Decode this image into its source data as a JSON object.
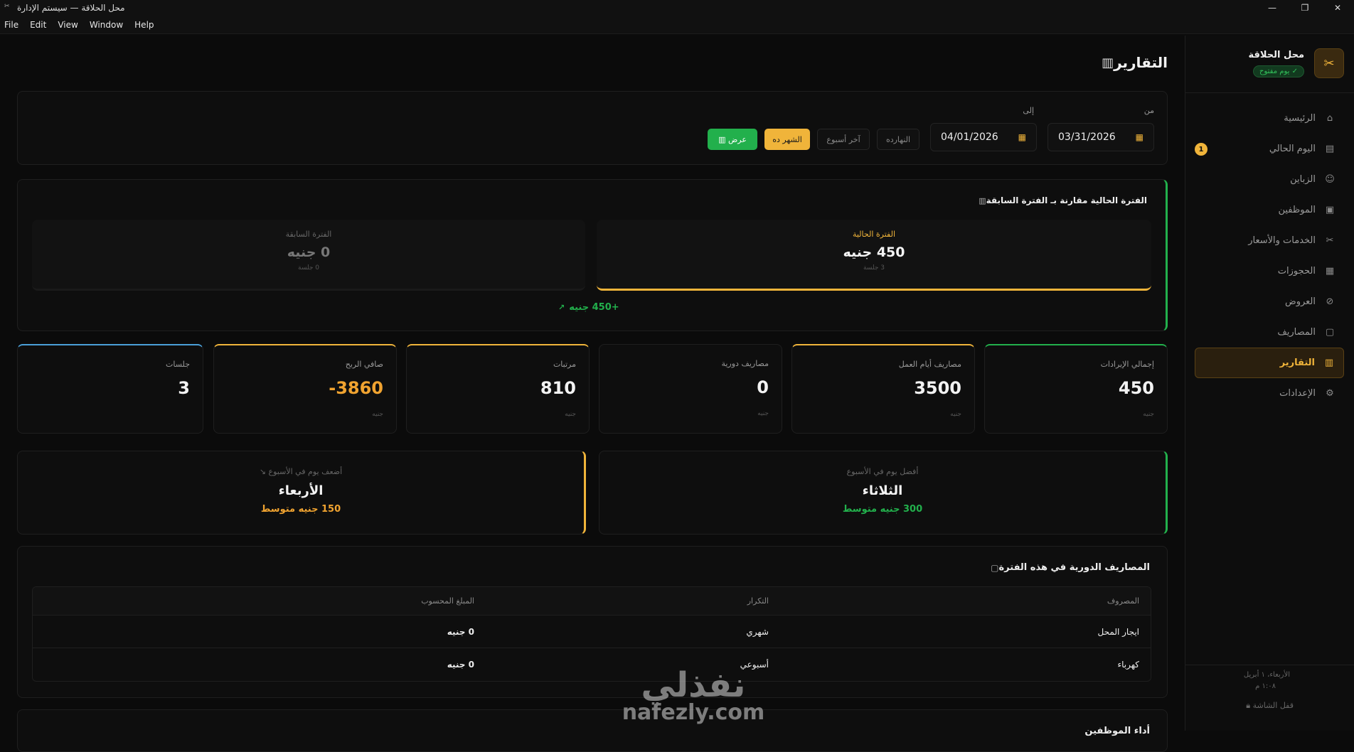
{
  "window": {
    "title": "محل الحلاقة — سيستم الإدارة",
    "controls": [
      "—",
      "❐",
      "✕"
    ]
  },
  "menubar": [
    "File",
    "Edit",
    "View",
    "Window",
    "Help"
  ],
  "sidebar": {
    "brand_name": "محل الحلاقة",
    "brand_status": "يوم مفتوح",
    "items": [
      {
        "label": "الرئيسية",
        "icon": "home-icon",
        "glyph": "⌂",
        "active": false
      },
      {
        "label": "اليوم الحالي",
        "icon": "calendar-today-icon",
        "glyph": "▤",
        "active": false,
        "badge": "1"
      },
      {
        "label": "الزباين",
        "icon": "users-icon",
        "glyph": "☺",
        "active": false
      },
      {
        "label": "الموظفين",
        "icon": "id-card-icon",
        "glyph": "▣",
        "active": false
      },
      {
        "label": "الخدمات والأسعار",
        "icon": "scissors-icon",
        "glyph": "✂",
        "active": false
      },
      {
        "label": "الحجوزات",
        "icon": "calendar-icon",
        "glyph": "▦",
        "active": false
      },
      {
        "label": "العروض",
        "icon": "tag-icon",
        "glyph": "⊘",
        "active": false
      },
      {
        "label": "المصاريف",
        "icon": "wallet-icon",
        "glyph": "▢",
        "active": false
      },
      {
        "label": "التقارير",
        "icon": "bar-chart-icon",
        "glyph": "▥",
        "active": true
      },
      {
        "label": "الإعدادات",
        "icon": "gear-icon",
        "glyph": "⚙",
        "active": false
      }
    ],
    "footer_date": "الأربعاء، ١ أبريل",
    "footer_time": "١:٠٨ م",
    "footer_lock": "قفل الشاشة"
  },
  "page": {
    "title": "التقارير"
  },
  "filter": {
    "from_label": "من",
    "to_label": "إلى",
    "from_value": "03/31/2026",
    "to_value": "04/01/2026",
    "today": "النهارده",
    "last_week": "آخر أسبوع",
    "this_month": "الشهر ده",
    "show": "عرض"
  },
  "comparison": {
    "title": "الفترة الحالية مقارنة بـ الفترة السابقة",
    "current_label": "الفترة الحالية",
    "current_value": "450 جنيه",
    "current_sub": "3 جلسة",
    "prev_label": "الفترة السابقة",
    "prev_value": "0 جنيه",
    "prev_sub": "0 جلسة",
    "diff": "+450 جنيه"
  },
  "stats": [
    {
      "label": "إجمالي الإيرادات",
      "value": "450",
      "unit": "جنيه"
    },
    {
      "label": "مصاريف أيام العمل",
      "value": "3500",
      "unit": "جنيه"
    },
    {
      "label": "مصاريف دورية",
      "value": "0",
      "unit": "جنيه"
    },
    {
      "label": "مرتبات",
      "value": "810",
      "unit": "جنيه"
    },
    {
      "label": "صافي الربح",
      "value": "-3860",
      "unit": "جنيه"
    },
    {
      "label": "جلسات",
      "value": "3",
      "unit": ""
    }
  ],
  "best_day": {
    "label": "أفضل يوم في الأسبوع",
    "name": "الثلاثاء",
    "avg": "300 جنيه متوسط"
  },
  "worst_day": {
    "label": "أضعف يوم في الأسبوع",
    "name": "الأربعاء",
    "avg": "150 جنيه متوسط"
  },
  "expenses": {
    "title": "المصاريف الدورية في هذه الفترة",
    "headers": [
      "المصروف",
      "التكرار",
      "المبلغ المحسوب"
    ],
    "rows": [
      [
        "ايجار المحل",
        "شهري",
        "0 جنيه"
      ],
      [
        "كهرباء",
        "أسبوعي",
        "0 جنيه"
      ]
    ]
  },
  "next_section": {
    "title": "أداء الموظفين"
  },
  "watermark": {
    "ar": "نفذلي",
    "en": "nafezly.com"
  }
}
